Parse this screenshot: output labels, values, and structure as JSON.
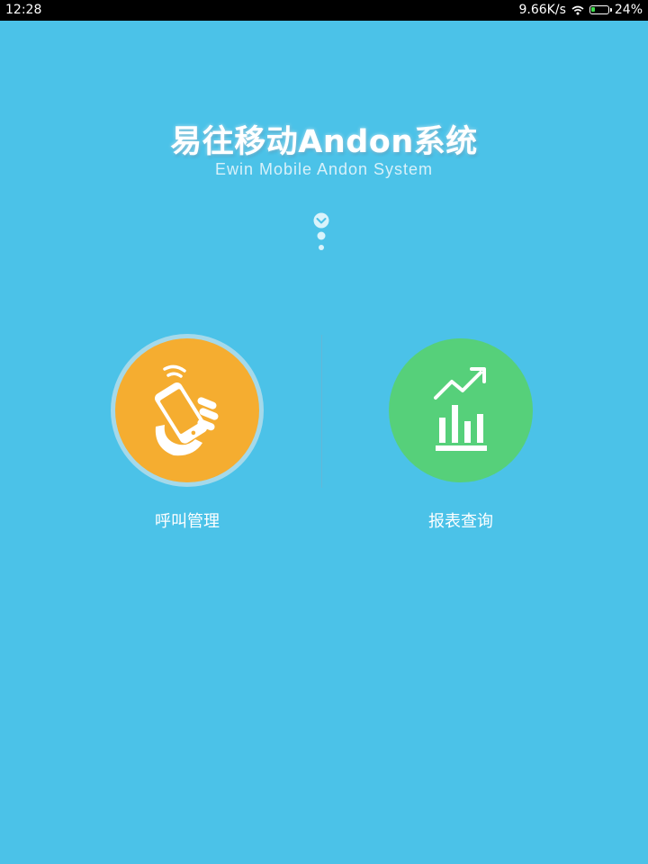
{
  "status_bar": {
    "time": "12:28",
    "network_speed": "9.66K/s",
    "battery_percent": "24%",
    "battery_level": 0.24
  },
  "header": {
    "title": "易往移动Andon系统",
    "subtitle": "Ewin Mobile Andon  System"
  },
  "menu": {
    "call_management": {
      "label": "呼叫管理",
      "icon": "hand-holding-phone-wifi-icon",
      "color": "#f5ad30"
    },
    "report_query": {
      "label": "报表查询",
      "icon": "bar-chart-trend-icon",
      "color": "#56d07a"
    }
  },
  "colors": {
    "background": "#4bc2e8",
    "status_bar": "#000000"
  }
}
